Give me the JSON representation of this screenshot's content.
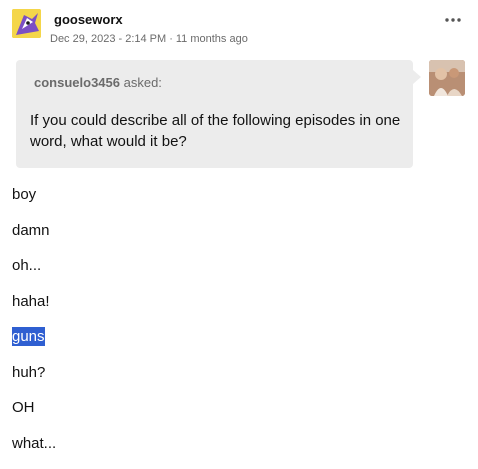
{
  "post": {
    "username": "gooseworx",
    "date": "Dec 29, 2023 - 2:14 PM",
    "separator": "·",
    "relative_time": "11 months ago",
    "more_icon": "ellipsis-icon"
  },
  "ask": {
    "asker": "consuelo3456",
    "asked_label": " asked:",
    "question": "If you could describe all of the following episodes in one word, what would it be?"
  },
  "answers": [
    {
      "text": "boy",
      "highlighted": false
    },
    {
      "text": "damn",
      "highlighted": false
    },
    {
      "text": "oh...",
      "highlighted": false
    },
    {
      "text": "haha!",
      "highlighted": false
    },
    {
      "text": "guns",
      "highlighted": true
    },
    {
      "text": "huh?",
      "highlighted": false
    },
    {
      "text": "OH",
      "highlighted": false
    },
    {
      "text": "what...",
      "highlighted": false
    }
  ],
  "colors": {
    "selection": "#2f5fd1",
    "ask_background": "#ececec",
    "meta_text": "#6b6b6b"
  }
}
